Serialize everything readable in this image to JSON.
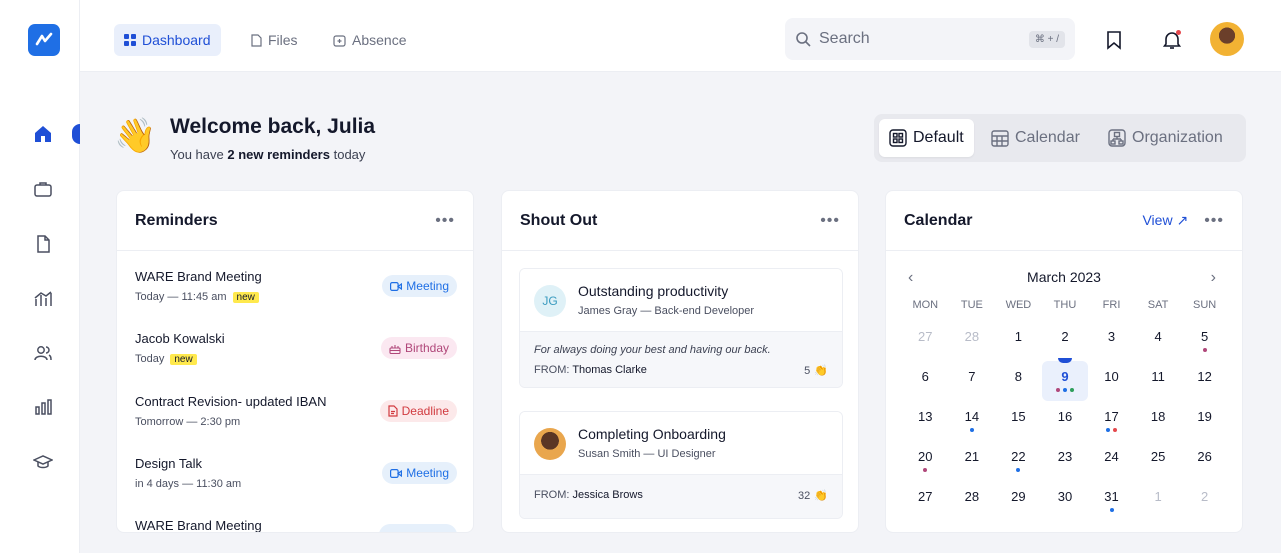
{
  "nav": {
    "tabs": [
      {
        "label": "Dashboard",
        "icon": "grid-icon"
      },
      {
        "label": "Files",
        "icon": "file-icon"
      },
      {
        "label": "Absence",
        "icon": "calendar-plus-icon"
      }
    ],
    "search_placeholder": "Search",
    "search_shortcut": "⌘ + /"
  },
  "welcome": {
    "title": "Welcome back, Julia",
    "sub_prefix": "You have",
    "sub_highlight": "2 new reminders",
    "sub_suffix": "today"
  },
  "view_switch": {
    "options": [
      "Default",
      "Calendar",
      "Organization"
    ],
    "active": "Default"
  },
  "reminders": {
    "title": "Reminders",
    "items": [
      {
        "title": "WARE Brand Meeting",
        "meta": "Today — 11:45 am",
        "new": "new",
        "tag": "Meeting"
      },
      {
        "title": "Jacob Kowalski",
        "meta": "Today",
        "new": "new",
        "tag": "Birthday"
      },
      {
        "title": "Contract Revision- updated IBAN",
        "meta": "Tomorrow — 2:30 pm",
        "new": "",
        "tag": "Deadline"
      },
      {
        "title": "Design Talk",
        "meta": "in 4 days — 11:30 am",
        "new": "",
        "tag": "Meeting"
      },
      {
        "title": "WARE Brand Meeting",
        "meta": "",
        "new": "",
        "tag": ""
      }
    ]
  },
  "shoutout": {
    "title": "Shout Out",
    "items": [
      {
        "initials": "JG",
        "title": "Outstanding productivity",
        "person": "James Gray — Back-end Developer",
        "message": "For always doing your best and having our back.",
        "from_label": "FROM:",
        "from": "Thomas Clarke",
        "count": "5"
      },
      {
        "initials": "",
        "title": "Completing Onboarding",
        "person": "Susan Smith — UI Designer",
        "message": "",
        "from_label": "FROM:",
        "from": "Jessica Brows",
        "count": "32"
      }
    ]
  },
  "calendar": {
    "title": "Calendar",
    "view_link": "View ↗",
    "month": "March 2023",
    "weekdays": [
      "MON",
      "TUE",
      "WED",
      "THU",
      "FRI",
      "SAT",
      "SUN"
    ],
    "weeks": [
      [
        {
          "d": "27",
          "m": true
        },
        {
          "d": "28",
          "m": true
        },
        {
          "d": "1"
        },
        {
          "d": "2"
        },
        {
          "d": "3"
        },
        {
          "d": "4"
        },
        {
          "d": "5",
          "dots": [
            "#b0477a"
          ]
        }
      ],
      [
        {
          "d": "6"
        },
        {
          "d": "7"
        },
        {
          "d": "8"
        },
        {
          "d": "9",
          "today": true,
          "dots": [
            "#b0477a",
            "#1f6fe5",
            "#2e9e5b"
          ]
        },
        {
          "d": "10"
        },
        {
          "d": "11"
        },
        {
          "d": "12"
        }
      ],
      [
        {
          "d": "13"
        },
        {
          "d": "14",
          "dots": [
            "#1f6fe5"
          ]
        },
        {
          "d": "15"
        },
        {
          "d": "16"
        },
        {
          "d": "17",
          "dots": [
            "#1f6fe5",
            "#e5484d"
          ]
        },
        {
          "d": "18"
        },
        {
          "d": "19"
        }
      ],
      [
        {
          "d": "20",
          "dots": [
            "#b0477a"
          ]
        },
        {
          "d": "21"
        },
        {
          "d": "22",
          "dots": [
            "#1f6fe5"
          ]
        },
        {
          "d": "23"
        },
        {
          "d": "24"
        },
        {
          "d": "25"
        },
        {
          "d": "26"
        }
      ],
      [
        {
          "d": "27"
        },
        {
          "d": "28"
        },
        {
          "d": "29"
        },
        {
          "d": "30"
        },
        {
          "d": "31",
          "dots": [
            "#1f6fe5"
          ]
        },
        {
          "d": "1",
          "m": true
        },
        {
          "d": "2",
          "m": true
        }
      ]
    ]
  },
  "colors": {
    "accent": "#1f4fd6",
    "meeting_bg": "#e6f0fb",
    "meeting_fg": "#1f6fe5",
    "birthday_bg": "#fbe8f1",
    "birthday_fg": "#b0477a",
    "deadline_bg": "#fce9ea",
    "deadline_fg": "#d13a3f"
  }
}
